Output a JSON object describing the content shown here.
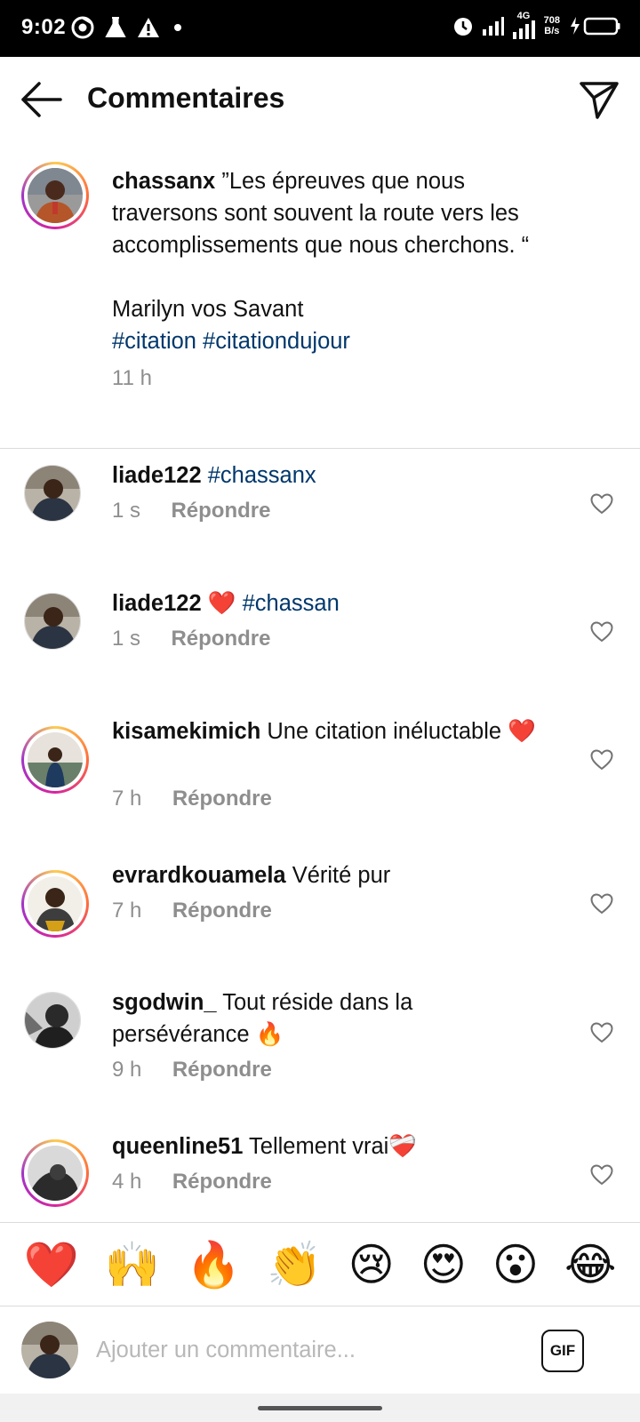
{
  "status_bar": {
    "time": "9:02",
    "network": "4G",
    "speed_value": "708",
    "speed_unit": "B/s"
  },
  "header": {
    "title": "Commentaires"
  },
  "caption": {
    "username": "chassanx",
    "text": "”Les épreuves que nous traversons sont souvent la route vers les accomplissements que nous cherchons. “",
    "author": "Marilyn vos Savant",
    "hashtags": "#citation #citationdujour",
    "time": "11 h"
  },
  "comments": [
    {
      "username": "liade122",
      "text": "",
      "tag": "#chassanx",
      "time": "1 s",
      "reply": "Répondre"
    },
    {
      "username": "liade122",
      "text": "❤️",
      "tag": "#chassan",
      "time": "1 s",
      "reply": "Répondre"
    },
    {
      "username": "kisamekimich",
      "text": "Une citation inéluctable ❤️",
      "tag": "",
      "time": "7 h",
      "reply": "Répondre"
    },
    {
      "username": "evrardkouamela",
      "text": "Vérité pur",
      "tag": "",
      "time": "7 h",
      "reply": "Répondre"
    },
    {
      "username": "sgodwin_",
      "text": "Tout réside dans la persévérance 🔥",
      "tag": "",
      "time": "9 h",
      "reply": "Répondre"
    },
    {
      "username": "queenline51",
      "text": "Tellement vrai❤️‍🩹",
      "tag": "",
      "time": "4 h",
      "reply": "Répondre"
    }
  ],
  "emoji_bar": [
    "❤️",
    "🙌",
    "🔥",
    "👏",
    "😢",
    "😍",
    "😮",
    "😂"
  ],
  "input": {
    "placeholder": "Ajouter un commentaire...",
    "gif_label": "GIF"
  }
}
